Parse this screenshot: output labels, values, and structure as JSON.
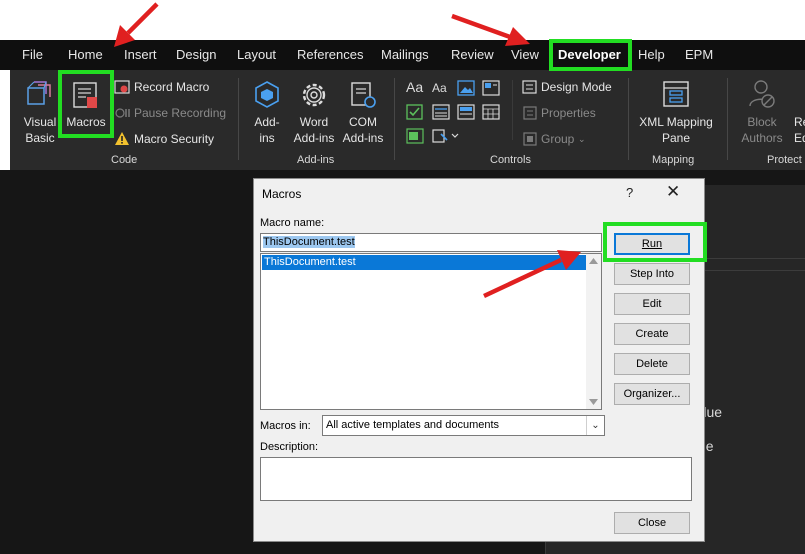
{
  "tabs": [
    "File",
    "Home",
    "Insert",
    "Design",
    "Layout",
    "References",
    "Mailings",
    "Review",
    "View",
    "Developer",
    "Help",
    "EPM"
  ],
  "ribbon": {
    "code": {
      "group_label": "Code",
      "visual_basic": [
        "Visual",
        "Basic"
      ],
      "macros": "Macros",
      "record_macro": "Record Macro",
      "pause_recording": "Pause Recording",
      "macro_security": "Macro Security"
    },
    "addins": {
      "group_label": "Add-ins",
      "addins": [
        "Add-",
        "ins"
      ],
      "word_addins": [
        "Word",
        "Add-ins"
      ],
      "com_addins": [
        "COM",
        "Add-ins"
      ]
    },
    "controls": {
      "group_label": "Controls",
      "design_mode": "Design Mode",
      "properties": "Properties",
      "group": "Group"
    },
    "mapping": {
      "group_label": "Mapping",
      "xml_mapping_pane": [
        "XML Mapping",
        "Pane"
      ]
    },
    "protect": {
      "group_label": "Protect",
      "block_authors": [
        "Block",
        "Authors"
      ],
      "restrict_editing": [
        "Re",
        "Ed"
      ]
    }
  },
  "document": {
    "visible_text_1": "Blue",
    "visible_text_2": "ue"
  },
  "macros_dialog": {
    "title": "Macros",
    "help_glyph": "?",
    "close_glyph": "✕",
    "macro_name_label": "Macro name:",
    "macro_name_value": "ThisDocument.test",
    "macro_list": [
      "ThisDocument.test"
    ],
    "buttons": {
      "run": "Run",
      "step_into": "Step Into",
      "edit": "Edit",
      "create": "Create",
      "delete": "Delete",
      "organizer": "Organizer...",
      "close": "Close"
    },
    "macros_in_label": "Macros in:",
    "macros_in_value": "All active templates and documents",
    "description_label": "Description:"
  },
  "annotations": {
    "highlight_color": "#22dd22",
    "arrow_color": "#e02020",
    "highlighted": [
      "Macros",
      "Developer",
      "Run"
    ],
    "arrows_point_to": [
      "Home",
      "Developer",
      "ThisDocument.test"
    ]
  },
  "colors": {
    "ribbon_bg": "#2a2a2a",
    "tabbar_bg": "#0f0f0f",
    "selection_blue": "#0a78d7"
  }
}
